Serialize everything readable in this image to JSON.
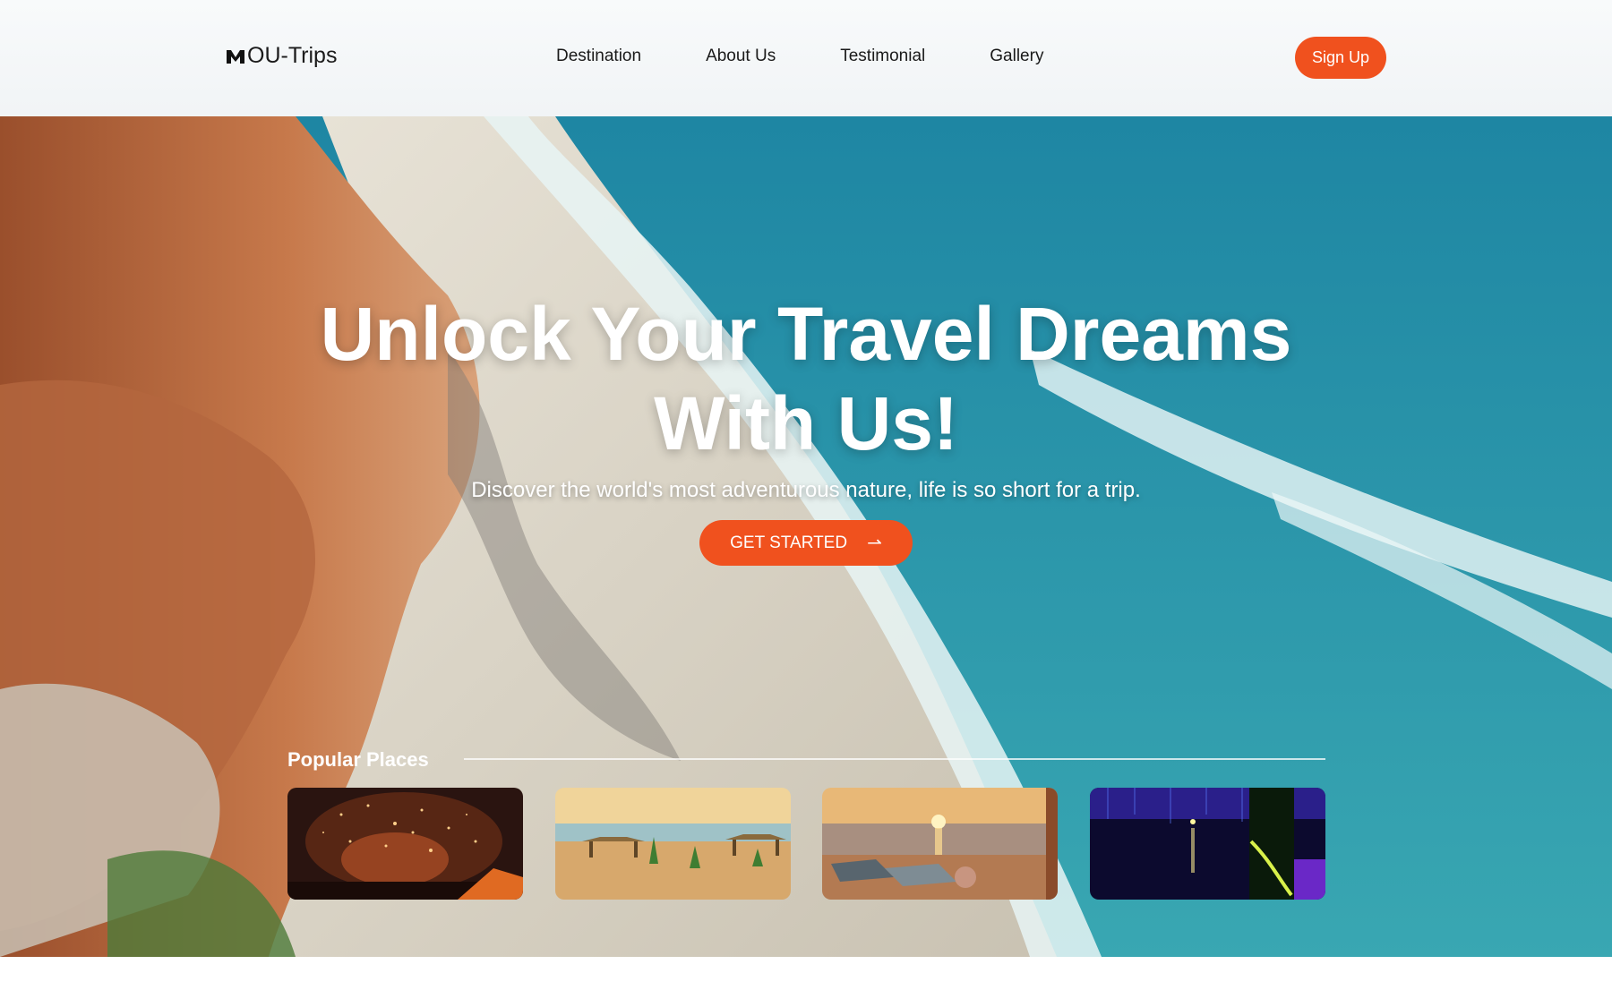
{
  "brand": {
    "name": "OU-Trips"
  },
  "nav": {
    "items": [
      {
        "label": "Destination"
      },
      {
        "label": "About Us"
      },
      {
        "label": "Testimonial"
      },
      {
        "label": "Gallery"
      }
    ],
    "signup_label": "Sign Up"
  },
  "hero": {
    "title_line1": "Unlock Your Travel Dreams",
    "title_line2": "With Us!",
    "subtitle": "Discover the world's most adventurous nature, life is so short for a trip.",
    "cta_label": "GET STARTED",
    "cta_icon": "arrow-right-icon"
  },
  "popular": {
    "title": "Popular Places",
    "places": [
      {
        "name": "fireworks-night"
      },
      {
        "name": "beach-huts-sunset"
      },
      {
        "name": "sunset-shore"
      },
      {
        "name": "glowing-night-forest"
      }
    ]
  },
  "colors": {
    "accent": "#f0511e",
    "header_bg": "#f4f6f8",
    "sea": "#2a9bb3",
    "sand": "#d9d4c8",
    "cliff": "#b5633b"
  }
}
